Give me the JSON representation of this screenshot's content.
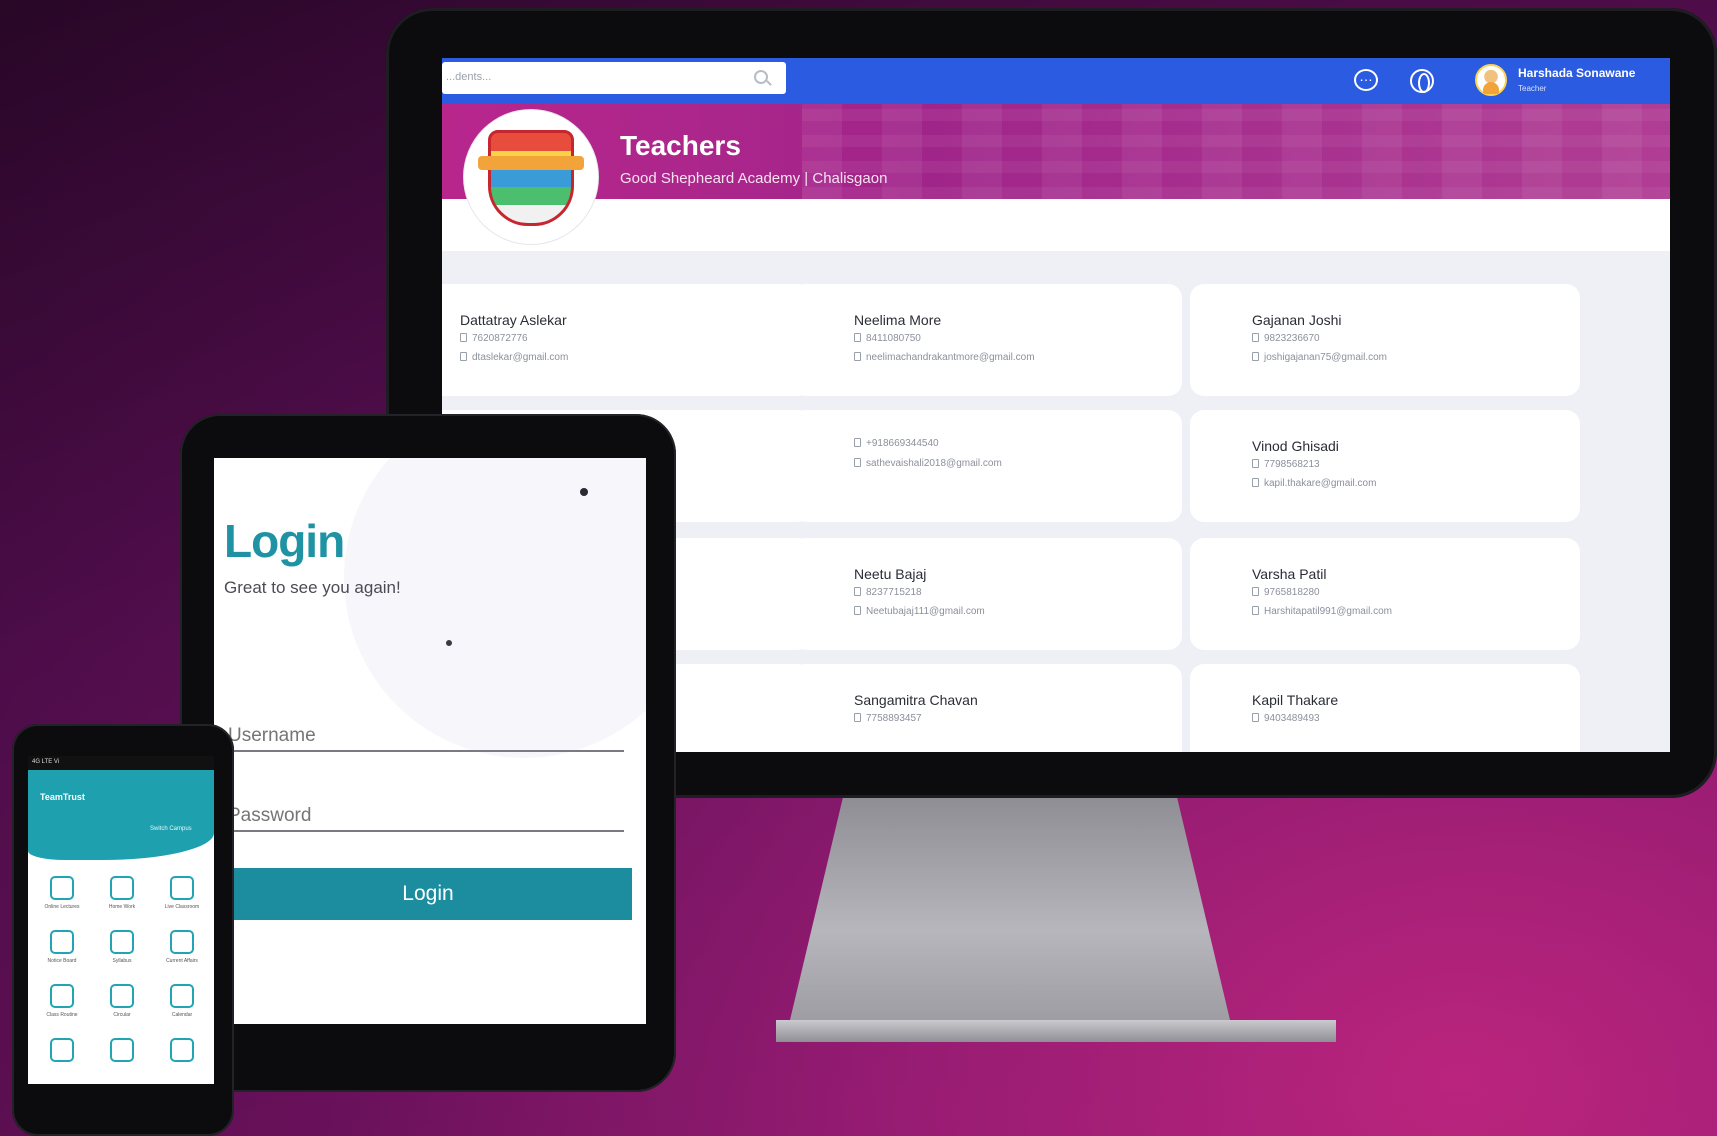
{
  "monitor": {
    "search": {
      "value": "...dents..."
    },
    "topbar": {
      "user_name": "Harshada Sonawane",
      "user_role": "Teacher"
    },
    "banner": {
      "title": "Teachers",
      "subtitle": "Good Shepheard Academy | Chalisgaon"
    },
    "teachers": [
      {
        "name": "Dattatray Aslekar",
        "phone": "7620872776",
        "email": "dtaslekar@gmail.com"
      },
      {
        "name": "Neelima More",
        "phone": "8411080750",
        "email": "neelimachandrakantmore@gmail.com"
      },
      {
        "name": "Gajanan Joshi",
        "phone": "9823236670",
        "email": "joshigajanan75@gmail.com"
      },
      {
        "name": "",
        "phone": "",
        "email": ""
      },
      {
        "name": "",
        "phone": "+918669344540",
        "email": "sathevaishali2018@gmail.com"
      },
      {
        "name": "Vinod Ghisadi",
        "phone": "7798568213",
        "email": "kapil.thakare@gmail.com"
      },
      {
        "name": "",
        "phone": "",
        "email": ""
      },
      {
        "name": "Neetu Bajaj",
        "phone": "8237715218",
        "email": "Neetubajaj111@gmail.com"
      },
      {
        "name": "Varsha Patil",
        "phone": "9765818280",
        "email": "Harshitapatil991@gmail.com"
      },
      {
        "name": "",
        "phone": "",
        "email": ""
      },
      {
        "name": "Sangamitra Chavan",
        "phone": "7758893457",
        "email": ""
      },
      {
        "name": "Kapil Thakare",
        "phone": "9403489493",
        "email": ""
      }
    ]
  },
  "tablet": {
    "title": "Login",
    "subtitle": "Great to see you again!",
    "username_placeholder": "Username",
    "password_placeholder": "Password",
    "login_button": "Login"
  },
  "phone": {
    "status": "4G LTE  Vi",
    "app_name": "TeamTrust",
    "switch_label": "Switch Campus",
    "tiles": [
      {
        "label": "Online Lectures",
        "icon": "lecture-icon"
      },
      {
        "label": "Home Work",
        "icon": "homework-icon"
      },
      {
        "label": "Live Classroom",
        "icon": "classroom-icon"
      },
      {
        "label": "Notice Board",
        "icon": "notice-icon"
      },
      {
        "label": "Syllabus",
        "icon": "syllabus-icon"
      },
      {
        "label": "Current Affairs",
        "icon": "affairs-icon"
      },
      {
        "label": "Class Routine",
        "icon": "routine-icon"
      },
      {
        "label": "Circular",
        "icon": "circular-icon"
      },
      {
        "label": "Calendar",
        "icon": "calendar-icon"
      },
      {
        "label": "",
        "icon": "chat-icon"
      },
      {
        "label": "",
        "icon": "library-icon"
      },
      {
        "label": "",
        "icon": "school-icon"
      }
    ]
  },
  "colors": {
    "topbar": "#2b5be0",
    "banner": "#b8268c",
    "teal": "#1b8d9e"
  }
}
